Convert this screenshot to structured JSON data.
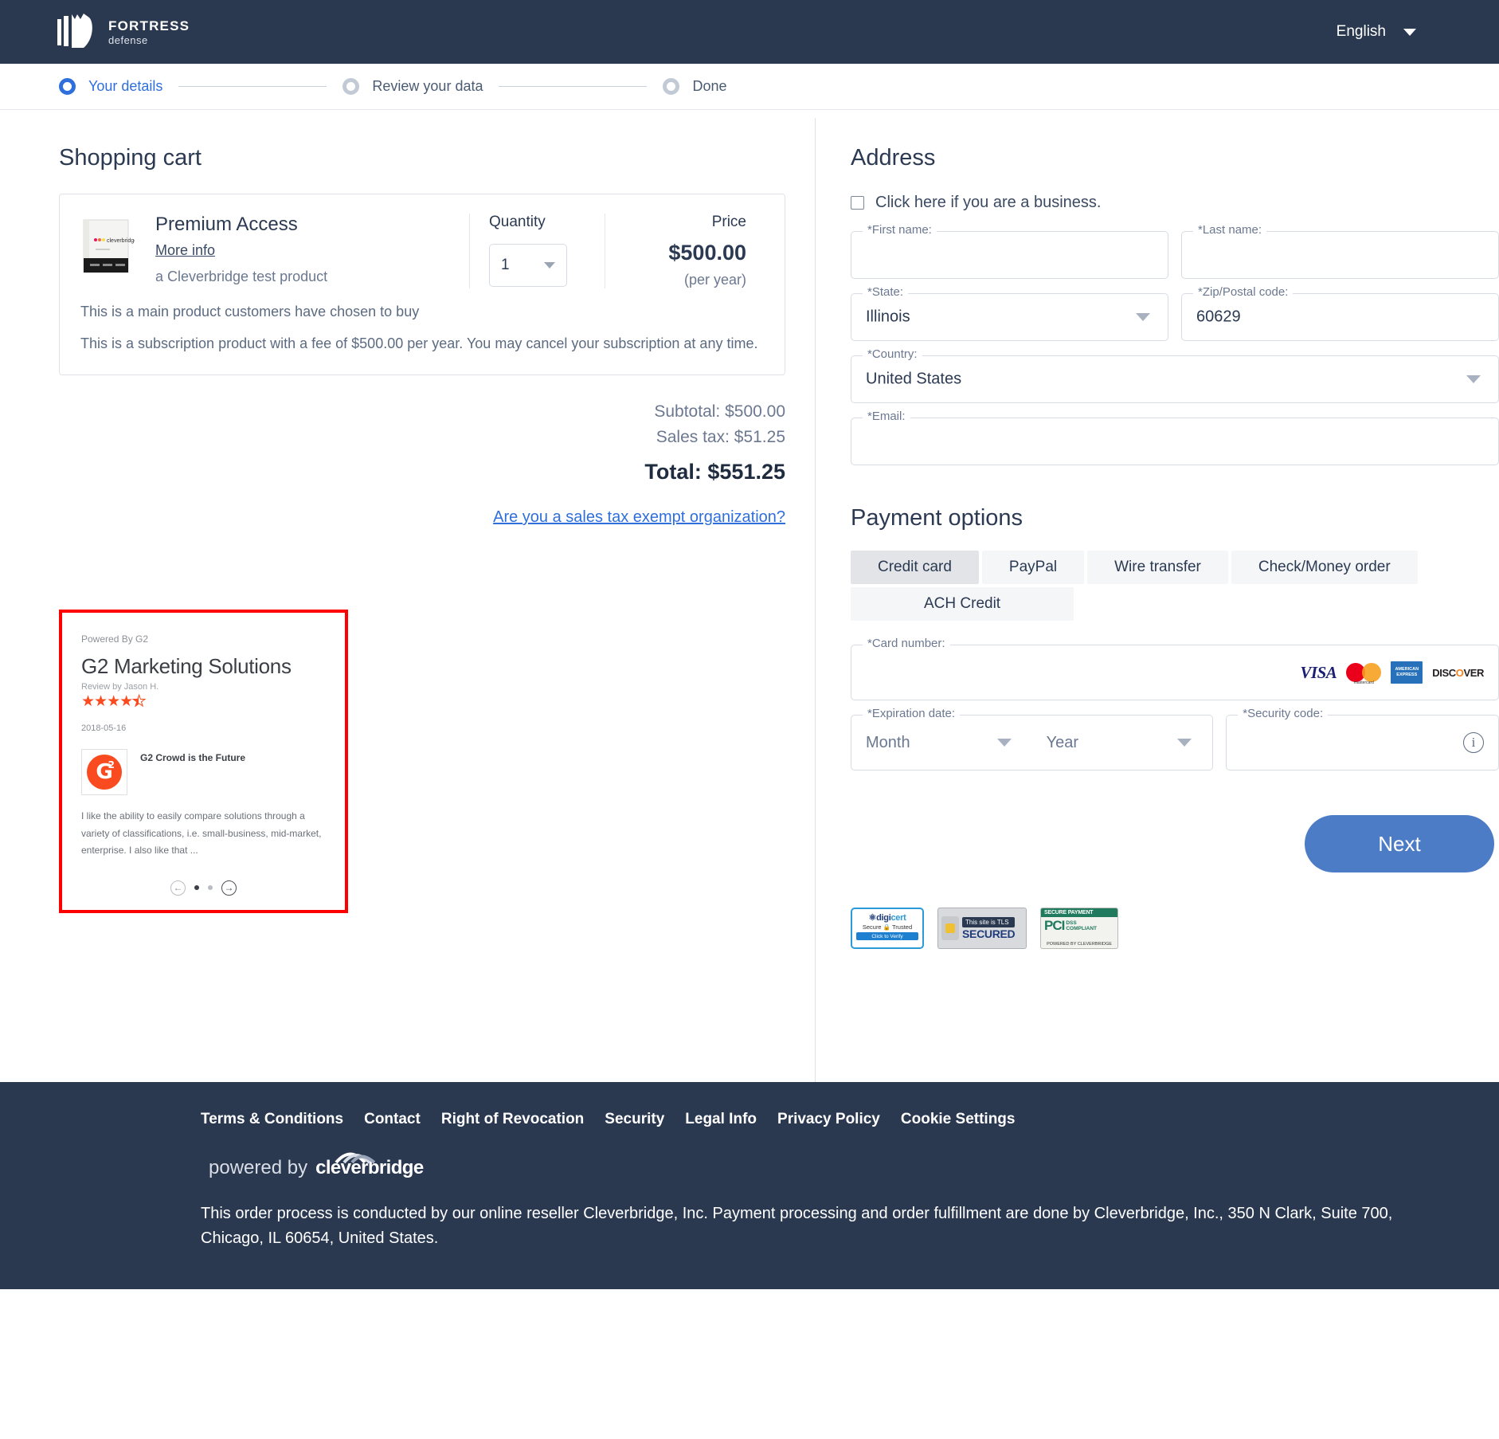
{
  "header": {
    "brand_name": "FORTRESS",
    "brand_sub": "defense",
    "language": "English"
  },
  "stepper": {
    "steps": [
      {
        "label": "Your details",
        "state": "active"
      },
      {
        "label": "Review your data",
        "state": "inactive"
      },
      {
        "label": "Done",
        "state": "inactive"
      }
    ]
  },
  "cart": {
    "title": "Shopping cart",
    "product": {
      "name": "Premium Access",
      "more_info": "More info",
      "subtitle": "a Cleverbridge test product",
      "image_label": "cleverbridge",
      "desc_1": "This is a main product customers have chosen to buy",
      "desc_2": "This is a subscription product with a fee of $500.00 per year. You may cancel your subscription at any time."
    },
    "quantity_label": "Quantity",
    "quantity_value": "1",
    "price_label": "Price",
    "price_value": "$500.00",
    "price_period": "(per year)"
  },
  "totals": {
    "subtotal": "Subtotal: $500.00",
    "sales_tax": "Sales tax: $51.25",
    "total": "Total: $551.25",
    "tax_exempt_link": "Are you a sales tax exempt organization?"
  },
  "g2": {
    "powered_by": "Powered By G2",
    "title": "G2 Marketing Solutions",
    "reviewer": "Review by Jason H.",
    "stars": "★★★★",
    "half_star": "★",
    "rating": 4.5,
    "date": "2018-05-16",
    "review_title": "G2 Crowd is the Future",
    "logo_text": "G",
    "logo_sup": "2",
    "quote": "I like the ability to easily compare solutions through a variety of classifications, i.e. small-business, mid-market, enterprise. I also like that ...",
    "prev_arrow": "←",
    "next_arrow": "→"
  },
  "address": {
    "title": "Address",
    "business_checkbox_label": "Click here if you are a business.",
    "fields": [
      {
        "label": "*First name:",
        "value": "",
        "type": "text"
      },
      {
        "label": "*Last name:",
        "value": "",
        "type": "text"
      },
      {
        "label": "*State:",
        "value": "Illinois",
        "type": "select"
      },
      {
        "label": "*Zip/Postal code:",
        "value": "60629",
        "type": "text"
      },
      {
        "label": "*Country:",
        "value": "United States",
        "type": "select"
      },
      {
        "label": "*Email:",
        "value": "",
        "type": "text"
      }
    ]
  },
  "payment": {
    "title": "Payment options",
    "tabs": [
      {
        "label": "Credit card",
        "selected": true
      },
      {
        "label": "PayPal",
        "selected": false
      },
      {
        "label": "Wire transfer",
        "selected": false
      },
      {
        "label": "Check/Money order",
        "selected": false
      },
      {
        "label": "ACH Credit",
        "selected": false
      }
    ],
    "card_number_label": "*Card number:",
    "card_number_value": "",
    "card_brands": [
      "VISA",
      "mastercard",
      "AMERICAN EXPRESS",
      "DISCOVER"
    ],
    "expiration_label": "*Expiration date:",
    "month_placeholder": "Month",
    "year_placeholder": "Year",
    "security_code_label": "*Security code:",
    "security_code_value": "",
    "next_button": "Next"
  },
  "badges": {
    "digicert_top": "digicert",
    "digicert_mid": "Secure 🔒 Trusted",
    "digicert_btm": "Click to Verify",
    "tls_top": "This site is TLS",
    "tls_bottom": "SECURED",
    "pci_top": "SECURE PAYMENT",
    "pci_main": "PCI",
    "pci_sub1": "DSS",
    "pci_sub2": "COMPLIANT",
    "pci_bottom": "POWERED BY CLEVERBRIDGE"
  },
  "footer": {
    "links": [
      "Terms & Conditions",
      "Contact",
      "Right of Revocation",
      "Security",
      "Legal Info",
      "Privacy Policy",
      "Cookie Settings"
    ],
    "powered_by": "powered by",
    "powered_brand": "cleverbridge",
    "note": "This order process is conducted by our online reseller Cleverbridge, Inc. Payment processing and order fulfillment are done by Cleverbridge, Inc., 350 N Clark, Suite 700, Chicago, IL 60654, United States."
  },
  "colors": {
    "navy": "#2a3850",
    "accent_blue": "#2f6fdb",
    "button_blue": "#4d7cc7",
    "highlight_red": "#ff0000",
    "g2_orange": "#f94b1f"
  }
}
